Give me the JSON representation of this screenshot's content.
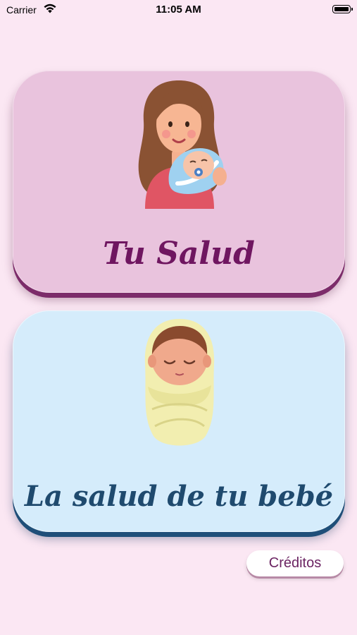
{
  "status_bar": {
    "carrier": "Carrier",
    "time": "11:05 AM"
  },
  "cards": {
    "health": {
      "title": "Tu Salud",
      "icon": "mother-holding-baby-icon",
      "background": "#e9c3dd",
      "accent": "#6f1660"
    },
    "baby": {
      "title": "La salud de tu bebé",
      "icon": "swaddled-baby-icon",
      "background": "#d5ecfb",
      "accent": "#1f4a6e"
    }
  },
  "credits_button": {
    "label": "Créditos"
  }
}
